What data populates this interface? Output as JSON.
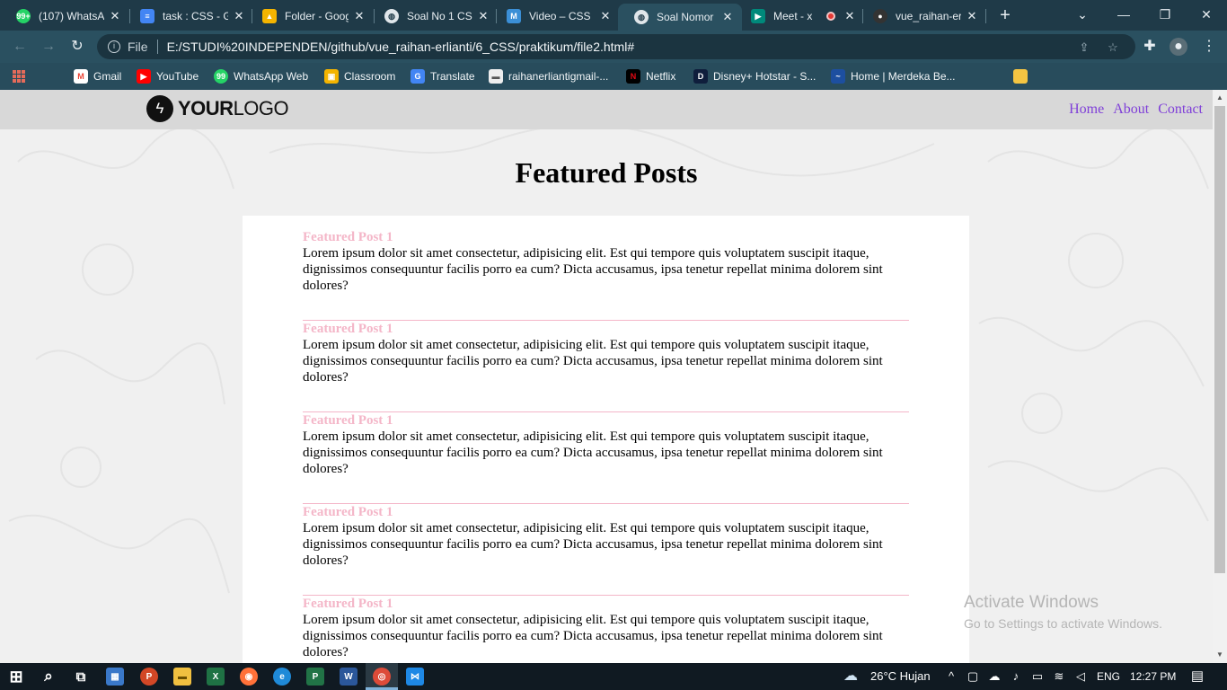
{
  "browser": {
    "tabs": [
      {
        "title": "(107) WhatsA",
        "icon": "whatsapp-icon",
        "color": "#25d366",
        "glyph": "99+"
      },
      {
        "title": "task : CSS - G",
        "icon": "google-docs-icon",
        "color": "#4285f4",
        "glyph": "≡"
      },
      {
        "title": "Folder - Goog",
        "icon": "google-drive-icon",
        "color": "#f4b400",
        "glyph": "▲"
      },
      {
        "title": "Soal No 1 CS",
        "icon": "globe-icon",
        "color": "#e0e6ea",
        "glyph": "◍"
      },
      {
        "title": "Video – CSS",
        "icon": "m-logo-icon",
        "color": "#3b8fd6",
        "glyph": "M"
      },
      {
        "title": "Soal Nomor",
        "icon": "globe-icon",
        "color": "#e0e6ea",
        "glyph": "◍"
      },
      {
        "title": "Meet - x",
        "icon": "google-meet-icon",
        "color": "#00897b",
        "glyph": "▶"
      },
      {
        "title": "vue_raihan-er",
        "icon": "github-icon",
        "color": "#333333",
        "glyph": "●"
      }
    ],
    "active_tab_index": 5,
    "address": {
      "scheme": "File",
      "url": "E:/STUDI%20INDEPENDEN/github/vue_raihan-erlianti/6_CSS/praktikum/file2.html#"
    },
    "bookmarks": [
      {
        "label": "Gmail",
        "icon": "gmail-icon",
        "color": "#ea4335",
        "glyph": "M"
      },
      {
        "label": "YouTube",
        "icon": "youtube-icon",
        "color": "#ff0000",
        "glyph": "▶"
      },
      {
        "label": "WhatsApp Web",
        "icon": "whatsapp-icon",
        "color": "#25d366",
        "glyph": "99"
      },
      {
        "label": "Classroom",
        "icon": "classroom-icon",
        "color": "#f4b400",
        "glyph": "▣"
      },
      {
        "label": "Translate",
        "icon": "translate-icon",
        "color": "#4285f4",
        "glyph": "G"
      },
      {
        "label": "raihanerliantigmail-...",
        "icon": "page-icon",
        "color": "#eeeeee",
        "glyph": "▬"
      },
      {
        "label": "Netflix",
        "icon": "netflix-icon",
        "color": "#e50914",
        "glyph": "N"
      },
      {
        "label": "Disney+ Hotstar - S...",
        "icon": "hotstar-icon",
        "color": "#0f1e3c",
        "glyph": "D"
      },
      {
        "label": "Home | Merdeka Be...",
        "icon": "merdeka-icon",
        "color": "#1d4fa0",
        "glyph": "~"
      },
      {
        "label": "",
        "icon": "folder-icon",
        "color": "#f5c542",
        "glyph": ""
      }
    ]
  },
  "page": {
    "logo": {
      "bold": "YOUR",
      "light": "LOGO"
    },
    "nav": [
      "Home",
      "About",
      "Contact"
    ],
    "title": "Featured Posts",
    "posts": [
      {
        "heading": "Featured Post 1",
        "body": "Lorem ipsum dolor sit amet consectetur, adipisicing elit. Est qui tempore quis voluptatem suscipit itaque, dignissimos consequuntur facilis porro ea cum? Dicta accusamus, ipsa tenetur repellat minima dolorem sint dolores?"
      },
      {
        "heading": "Featured Post 1",
        "body": "Lorem ipsum dolor sit amet consectetur, adipisicing elit. Est qui tempore quis voluptatem suscipit itaque, dignissimos consequuntur facilis porro ea cum? Dicta accusamus, ipsa tenetur repellat minima dolorem sint dolores?"
      },
      {
        "heading": "Featured Post 1",
        "body": "Lorem ipsum dolor sit amet consectetur, adipisicing elit. Est qui tempore quis voluptatem suscipit itaque, dignissimos consequuntur facilis porro ea cum? Dicta accusamus, ipsa tenetur repellat minima dolorem sint dolores?"
      },
      {
        "heading": "Featured Post 1",
        "body": "Lorem ipsum dolor sit amet consectetur, adipisicing elit. Est qui tempore quis voluptatem suscipit itaque, dignissimos consequuntur facilis porro ea cum? Dicta accusamus, ipsa tenetur repellat minima dolorem sint dolores?"
      },
      {
        "heading": "Featured Post 1",
        "body": "Lorem ipsum dolor sit amet consectetur, adipisicing elit. Est qui tempore quis voluptatem suscipit itaque, dignissimos consequuntur facilis porro ea cum? Dicta accusamus, ipsa tenetur repellat minima dolorem sint dolores?"
      }
    ],
    "accent_color": "#f4b6c8",
    "link_color": "#7f3fd8"
  },
  "watermark": {
    "line1": "Activate Windows",
    "line2": "Go to Settings to activate Windows."
  },
  "taskbar": {
    "apps": [
      {
        "name": "start-icon",
        "color": "#ffffff",
        "glyph": "⊞"
      },
      {
        "name": "search-icon",
        "color": "#ffffff",
        "glyph": "⌕"
      },
      {
        "name": "task-view-icon",
        "color": "#ffffff",
        "glyph": "⧉"
      },
      {
        "name": "store-icon",
        "color": "#3a78c9",
        "glyph": "▦"
      },
      {
        "name": "powerpoint-icon",
        "color": "#d24726",
        "glyph": "P"
      },
      {
        "name": "file-explorer-icon",
        "color": "#f0c040",
        "glyph": "▬"
      },
      {
        "name": "excel-icon",
        "color": "#1f7244",
        "glyph": "X"
      },
      {
        "name": "firefox-icon",
        "color": "#ff7139",
        "glyph": "◉"
      },
      {
        "name": "edge-icon",
        "color": "#1f8ad8",
        "glyph": "e"
      },
      {
        "name": "project-icon",
        "color": "#217346",
        "glyph": "P"
      },
      {
        "name": "word-icon",
        "color": "#2b579a",
        "glyph": "W"
      },
      {
        "name": "chrome-icon",
        "color": "#dd4b39",
        "glyph": "◎"
      },
      {
        "name": "vscode-icon",
        "color": "#1e88e5",
        "glyph": "⋈"
      }
    ],
    "weather": "26°C  Hujan",
    "language": "ENG",
    "time": "12:27 PM"
  }
}
